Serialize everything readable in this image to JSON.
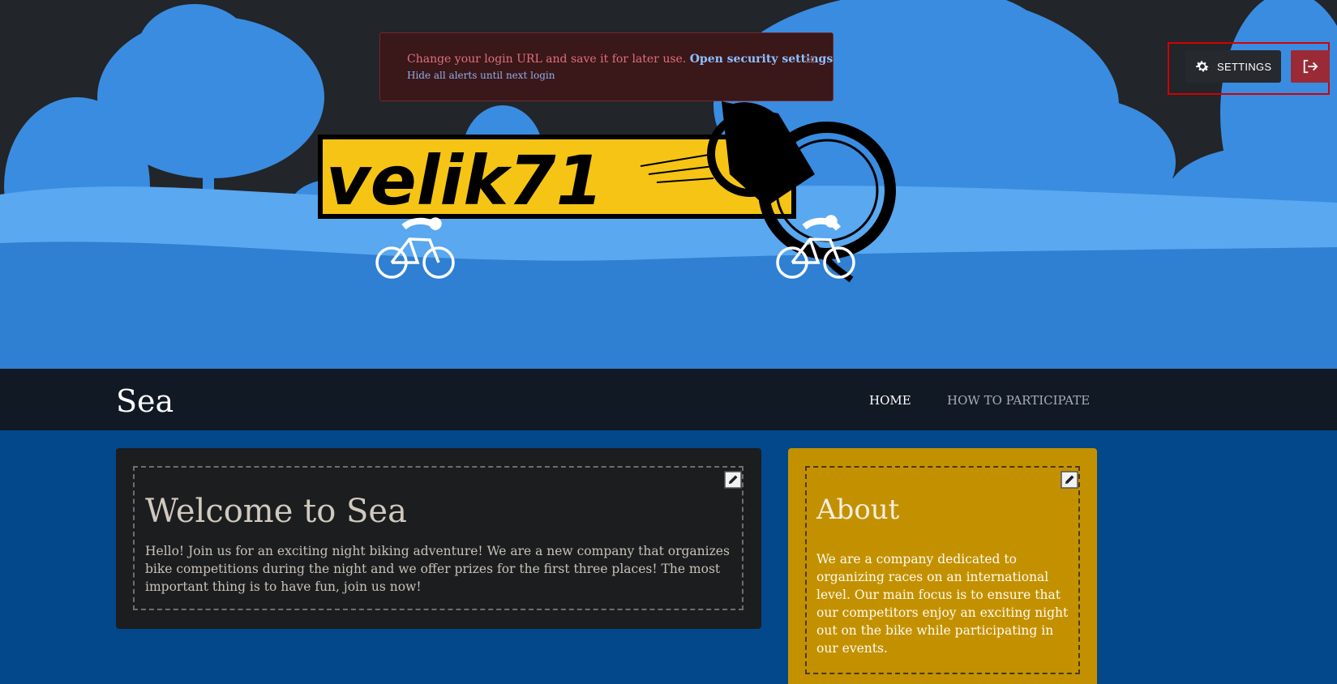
{
  "alert": {
    "message": "Change your login URL and save it for later use.",
    "link_label": "Open security settings",
    "hide_label": "Hide all alerts until next login",
    "close_glyph": "×"
  },
  "top_controls": {
    "settings_label": "SETTINGS",
    "settings_icon": "gear-icon",
    "logout_icon": "logout-icon"
  },
  "hero": {
    "logo_text": "velik71"
  },
  "nav": {
    "site_title": "Sea",
    "items": [
      {
        "label": "HOME",
        "active": true
      },
      {
        "label": "HOW TO PARTICIPATE",
        "active": false
      }
    ]
  },
  "welcome": {
    "title": "Welcome to Sea",
    "text": "Hello! Join us for an exciting night biking adventure! We are a new company that organizes bike competitions during the night and we offer prizes for the first three places! The most important thing is to have fun, join us now!",
    "edit_icon": "edit-icon"
  },
  "about": {
    "title": "About",
    "text": "We are a company dedicated to organizing races on an international level. Our main focus is to ensure that our competitors enjoy an exciting night out on the bike while participating in our events.",
    "edit_icon": "edit-icon"
  },
  "colors": {
    "hero_bg": "#222529",
    "trees": "#3a8ce0",
    "ground": "#2f7fd2",
    "logo_yellow": "#f6c414",
    "navbar": "#111a24",
    "page_bg": "#03488a",
    "about_card": "#c39100",
    "alert_bg": "#3a1719",
    "logout_red": "#9b2a37"
  }
}
